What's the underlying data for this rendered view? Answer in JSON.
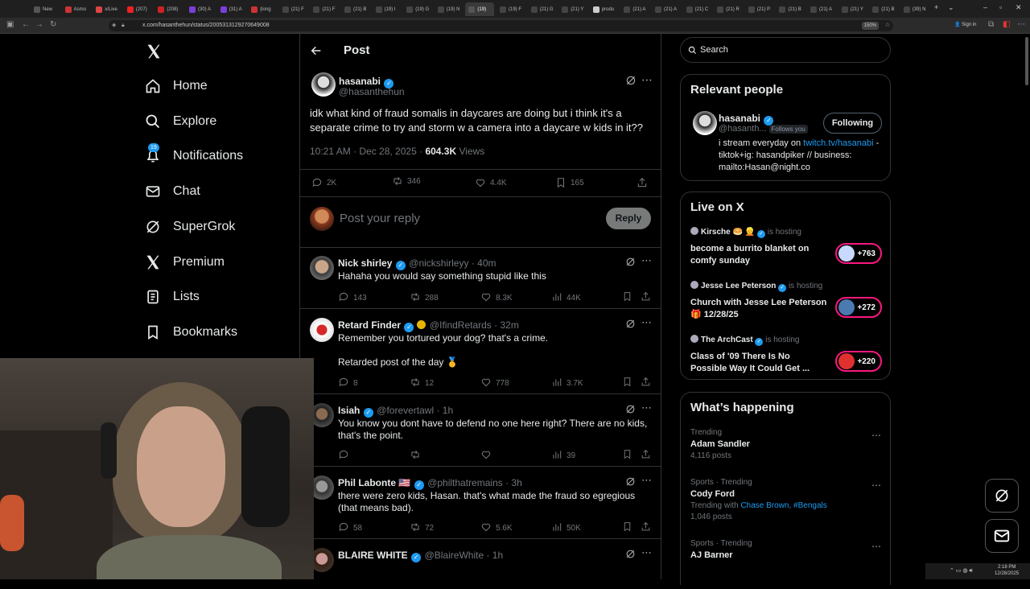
{
  "browser": {
    "tabs": [
      "New",
      "Asmo",
      "x/Live",
      "(207)",
      "(208)",
      "(30) A",
      "(31) A",
      "(long",
      "(21) F",
      "(21) F",
      "(21) B",
      "(19) I",
      "(19) G",
      "(19) N",
      "(19)",
      "(19) F",
      "(21) G",
      "(21) Y",
      "produ",
      "(21) A",
      "(21) A",
      "(21) C",
      "(21) R",
      "(21) P",
      "(21) B",
      "(21) A",
      "(21) Y",
      "(21) B",
      "(39) N"
    ],
    "url": "x.com/hasanthehun/status/2005313129270649008",
    "zoom": "150%",
    "signin": "Sign in"
  },
  "sidebar": {
    "items": [
      {
        "label": "Home",
        "icon": "home-icon"
      },
      {
        "label": "Explore",
        "icon": "search-icon"
      },
      {
        "label": "Notifications",
        "icon": "bell-icon",
        "badge": "19"
      },
      {
        "label": "Chat",
        "icon": "mail-icon"
      },
      {
        "label": "SuperGrok",
        "icon": "grok-icon"
      },
      {
        "label": "Premium",
        "icon": "x-logo-icon"
      },
      {
        "label": "Lists",
        "icon": "list-icon"
      },
      {
        "label": "Bookmarks",
        "icon": "bookmark-icon"
      }
    ]
  },
  "header": {
    "title": "Post"
  },
  "post": {
    "name": "hasanabi",
    "handle": "@hasanthehun",
    "text": "idk what kind of fraud somalis in daycares are doing but i think it's a separate crime to try and storm w a camera into a daycare w kids in it??",
    "time": "10:21 AM · Dec 28, 2025 ·",
    "views": "604.3K",
    "views_label": "Views",
    "replies": "2K",
    "reposts": "346",
    "likes": "4.4K",
    "bookmarks": "165"
  },
  "reply_box": {
    "placeholder": "Post your reply",
    "button": "Reply"
  },
  "replies": [
    {
      "name": "Nick shirley",
      "handle": "@nickshirleyy · 40m",
      "text": "Hahaha you would say something stupid like this",
      "replies": "143",
      "reposts": "288",
      "likes": "8.3K",
      "views": "44K"
    },
    {
      "name": "Retard Finder",
      "handle": "@IfindRetards · 32m",
      "text": "Remember you tortured your dog? that's a crime.",
      "text2": "Retarded post of the day 🥇",
      "replies": "8",
      "reposts": "12",
      "likes": "778",
      "views": "3.7K"
    },
    {
      "name": "Isiah",
      "handle": "@forevertawl · 1h",
      "text": "You know you dont have to defend no one here right? There are no kids, that's the point.",
      "replies": "",
      "reposts": "",
      "likes": "",
      "views": "39"
    },
    {
      "name": "Phil Labonte 🇺🇸",
      "handle": "@philthatremains · 3h",
      "text": "there were zero kids, Hasan. that's what made the fraud so egregious (that means bad).",
      "replies": "58",
      "reposts": "72",
      "likes": "5.6K",
      "views": "50K"
    },
    {
      "name": "BLAIRE WHITE",
      "handle": "@BlaireWhite · 1h",
      "text": "",
      "replies": "",
      "reposts": "",
      "likes": "",
      "views": ""
    }
  ],
  "search": {
    "placeholder": "Search"
  },
  "relevant": {
    "title": "Relevant people",
    "name": "hasanabi",
    "handle": "@hasanth...",
    "follows_you": "Follows you",
    "button": "Following",
    "bio_pre": "i stream everyday on ",
    "bio_link": "twitch.tv/hasanabi",
    "bio_post": " - tiktok+ig: hasandpiker // business: mailto:Hasan@night.co"
  },
  "live": {
    "title": "Live on X",
    "items": [
      {
        "host": "Kirsche 🥯 👱",
        "status": "is hosting",
        "title": "become a burrito blanket on comfy sunday",
        "count": "+763"
      },
      {
        "host": "Jesse Lee Peterson",
        "status": "is hosting",
        "title": "Church with Jesse Lee Peterson 🎁 12/28/25",
        "count": "+272"
      },
      {
        "host": "The ArchCast",
        "status": "is hosting",
        "title": "Class of '09 There Is No Possible Way It Could Get ...",
        "count": "+220"
      }
    ]
  },
  "happening": {
    "title": "What’s happening",
    "items": [
      {
        "context": "Trending",
        "name": "Adam Sandler",
        "meta": "4,116 posts",
        "with_label": "",
        "with_links": ""
      },
      {
        "context": "Sports · Trending",
        "name": "Cody Ford",
        "meta": "1,046 posts",
        "with_label": "Trending with ",
        "with_links": "Chase Brown, #Bengals"
      },
      {
        "context": "Sports · Trending",
        "name": "AJ Barner",
        "meta": "",
        "with_label": "",
        "with_links": ""
      }
    ]
  },
  "taskbar": {
    "time": "2:18 PM",
    "date": "12/28/2025"
  }
}
